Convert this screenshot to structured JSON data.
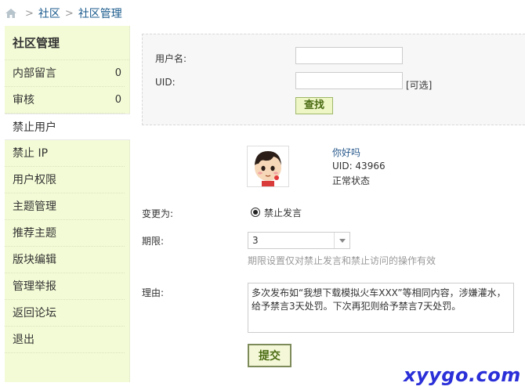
{
  "breadcrumb": {
    "items": [
      "社区",
      "社区管理"
    ],
    "separator": ">"
  },
  "sidebar": {
    "title": "社区管理",
    "items": [
      {
        "label": "内部留言",
        "count": "0"
      },
      {
        "label": "审核",
        "count": "0"
      },
      {
        "label": "禁止用户"
      },
      {
        "label": "禁止 IP"
      },
      {
        "label": "用户权限"
      },
      {
        "label": "主题管理"
      },
      {
        "label": "推荐主题"
      },
      {
        "label": "版块编辑"
      },
      {
        "label": "管理举报"
      },
      {
        "label": "返回论坛"
      },
      {
        "label": "退出"
      }
    ],
    "active_index": 2
  },
  "search": {
    "username_label": "用户名:",
    "username_value": "",
    "uid_label": "UID:",
    "uid_value": "",
    "uid_note": "[可选]",
    "search_button": "查找"
  },
  "user": {
    "name": "你好吗",
    "uid": "UID: 43966",
    "status": "正常状态"
  },
  "form": {
    "change_label": "变更为:",
    "change_option": "禁止发言",
    "period_label": "期限:",
    "period_value": "3",
    "period_hint": "期限设置仅对禁止发言和禁止访问的操作有效",
    "reason_label": "理由:",
    "reason_text": "多次发布如“我想下载模拟火车XXX”等相同内容，涉嫌灌水，给予禁言3天处罚。下次再犯则给予禁言7天处罚。",
    "submit_button": "提交"
  },
  "watermark": "xyygo.com",
  "colors": {
    "sidebar_bg": "#f3fbd6",
    "link": "#1a5a8c",
    "button_bg": "#eef6c6",
    "button_text": "#4a6b12",
    "watermark": "#2a2fd8"
  }
}
